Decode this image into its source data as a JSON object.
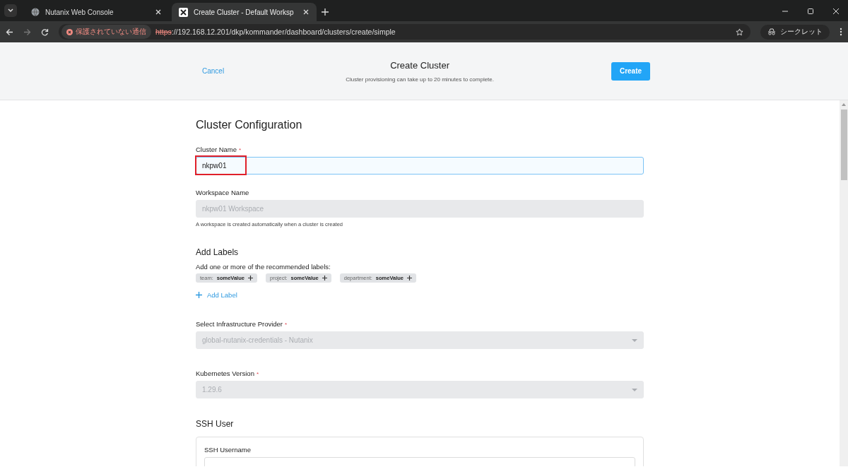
{
  "browser": {
    "tabs": [
      {
        "title": "Nutanix Web Console",
        "selected": false
      },
      {
        "title": "Create Cluster - Default Worksp",
        "selected": true
      }
    ],
    "security_label": "保護されていない通信",
    "url_scheme": "https",
    "url_rest": "://192.168.12.201/dkp/kommander/dashboard/clusters/create/simple",
    "profile": "シークレット"
  },
  "header": {
    "cancel": "Cancel",
    "title": "Create Cluster",
    "subtitle": "Cluster provisioning can take up to 20 minutes to complete.",
    "create": "Create"
  },
  "section_title": "Cluster Configuration",
  "fields": [
    {
      "label": "Cluster Name",
      "required": true,
      "required_mark": "*",
      "value": "nkpw01",
      "disabled": false,
      "focused": true,
      "highlighted": true
    },
    {
      "label": "Workspace Name",
      "placeholder": "nkpw01 Workspace",
      "disabled": true,
      "focused": false,
      "help": "A workspace is created automatically when a cluster is created"
    }
  ],
  "labels": {
    "title": "Add Labels",
    "subtitle": "Add one or more of the recommended labels:",
    "chips": [
      {
        "key": "team:",
        "value": "someValue"
      },
      {
        "key": "project:",
        "value": "someValue"
      },
      {
        "key": "department:",
        "value": "someValue"
      }
    ],
    "add": "Add Label"
  },
  "selects": [
    {
      "label": "Select Infrastructure Provider",
      "required": true,
      "required_mark": "*",
      "value": "global-nutanix-credentials - Nutanix",
      "disabled": true
    },
    {
      "label": "Kubernetes Version",
      "required": true,
      "required_mark": "*",
      "value": "1.29.6",
      "disabled": true
    }
  ],
  "ssh": {
    "title": "SSH User",
    "username_label": "SSH Username"
  }
}
